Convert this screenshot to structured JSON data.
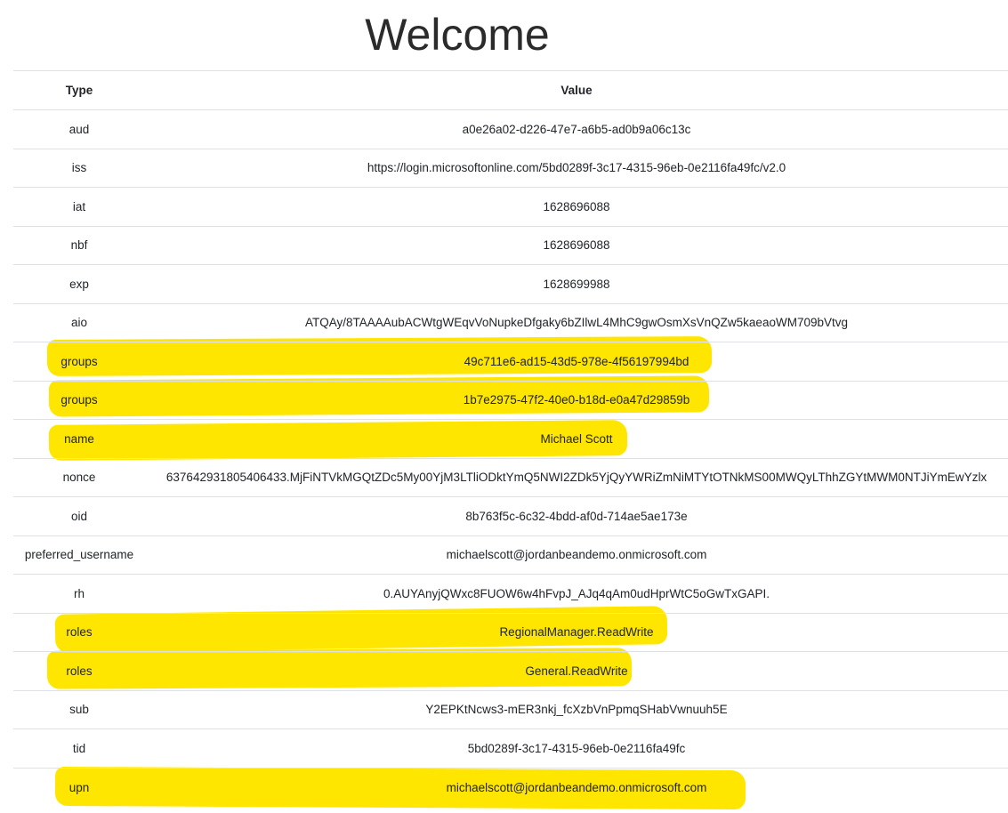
{
  "header": {
    "title": "Welcome"
  },
  "table": {
    "columns": [
      "Type",
      "Value"
    ],
    "rows": [
      {
        "type": "aud",
        "value": "a0e26a02-d226-47e7-a6b5-ad0b9a06c13c",
        "highlighted": false
      },
      {
        "type": "iss",
        "value": "https://login.microsoftonline.com/5bd0289f-3c17-4315-96eb-0e2116fa49fc/v2.0",
        "highlighted": false
      },
      {
        "type": "iat",
        "value": "1628696088",
        "highlighted": false
      },
      {
        "type": "nbf",
        "value": "1628696088",
        "highlighted": false
      },
      {
        "type": "exp",
        "value": "1628699988",
        "highlighted": false
      },
      {
        "type": "aio",
        "value": "ATQAy/8TAAAAubACWtgWEqvVoNupkeDfgaky6bZIlwL4MhC9gwOsmXsVnQZw5kaeaoWM709bVtvg",
        "highlighted": false
      },
      {
        "type": "groups",
        "value": "49c711e6-ad15-43d5-978e-4f56197994bd",
        "highlighted": true
      },
      {
        "type": "groups",
        "value": "1b7e2975-47f2-40e0-b18d-e0a47d29859b",
        "highlighted": true
      },
      {
        "type": "name",
        "value": "Michael Scott",
        "highlighted": true
      },
      {
        "type": "nonce",
        "value": "637642931805406433.MjFiNTVkMGQtZDc5My00YjM3LTliODktYmQ5NWI2ZDk5YjQyYWRiZmNiMTYtOTNkMS00MWQyLThhZGYtMWM0NTJiYmEwYzlx",
        "highlighted": false
      },
      {
        "type": "oid",
        "value": "8b763f5c-6c32-4bdd-af0d-714ae5ae173e",
        "highlighted": false
      },
      {
        "type": "preferred_username",
        "value": "michaelscott@jordanbeandemo.onmicrosoft.com",
        "highlighted": false
      },
      {
        "type": "rh",
        "value": "0.AUYAnyjQWxc8FUOW6w4hFvpJ_AJq4qAm0udHprWtC5oGwTxGAPI.",
        "highlighted": false
      },
      {
        "type": "roles",
        "value": "RegionalManager.ReadWrite",
        "highlighted": true
      },
      {
        "type": "roles",
        "value": "General.ReadWrite",
        "highlighted": true
      },
      {
        "type": "sub",
        "value": "Y2EPKtNcws3-mER3nkj_fcXzbVnPpmqSHabVwnuuh5E",
        "highlighted": false
      },
      {
        "type": "tid",
        "value": "5bd0289f-3c17-4315-96eb-0e2116fa49fc",
        "highlighted": false
      },
      {
        "type": "upn",
        "value": "michaelscott@jordanbeandemo.onmicrosoft.com",
        "highlighted": true
      }
    ]
  },
  "colors": {
    "highlight": "#ffe600",
    "border": "#dee2e6",
    "text": "#212529"
  }
}
